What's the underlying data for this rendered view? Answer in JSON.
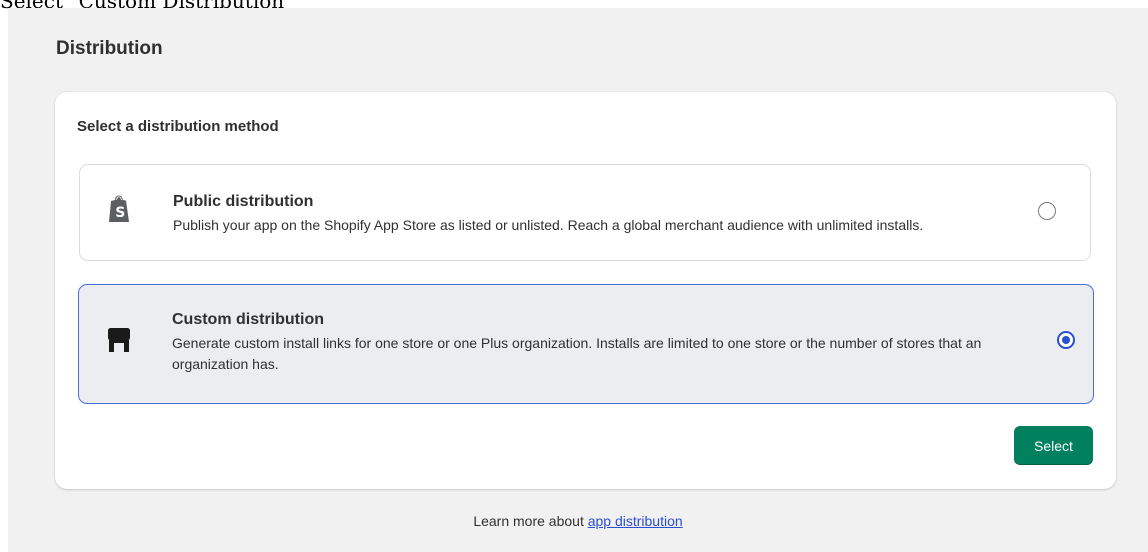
{
  "caption": "Select \"Custom Distribution\"",
  "page": {
    "title": "Distribution"
  },
  "card": {
    "heading": "Select a distribution method",
    "options": [
      {
        "id": "public",
        "title": "Public distribution",
        "description": "Publish your app on the Shopify App Store as listed or unlisted. Reach a global merchant audience with unlimited installs.",
        "icon": "shopify-bag-icon",
        "selected": false
      },
      {
        "id": "custom",
        "title": "Custom distribution",
        "description": "Generate custom install links for one store or one Plus organization. Installs are limited to one store or the number of stores that an organization has.",
        "icon": "storefront-icon",
        "selected": true
      }
    ],
    "select_label": "Select"
  },
  "footer": {
    "prefix": "Learn more about ",
    "link_text": "app distribution"
  },
  "colors": {
    "primary_button": "#00805e",
    "selected_border": "#4a6fd8",
    "selected_bg": "#ebedf1",
    "link": "#2c4fcf"
  }
}
